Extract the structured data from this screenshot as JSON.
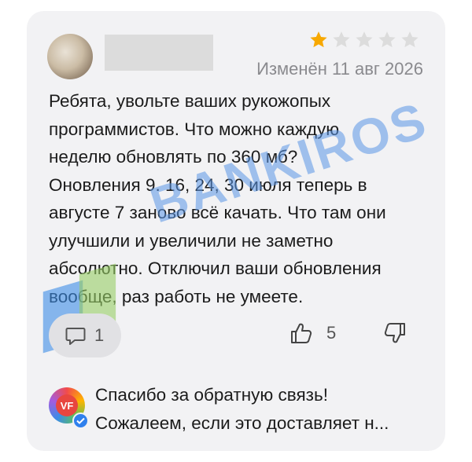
{
  "review": {
    "author_avatar": "user-avatar",
    "rating": 1,
    "max_rating": 5,
    "date": "Изменён 11 авг 2026",
    "text": "Ребята, увольте ваших рукожопых\nпрограммистов. Что можно каждую\nнеделю обновлять по 360 мб?\nОновления 9. 16, 24, 30 июля теперь в\nавгусте 7 заново всё качать. Что там они\nулучшили и увеличили не заметно\nабсолютно. Отключил ваши обновления\nвообще, раз работь не умеете."
  },
  "actions": {
    "comments_count": "1",
    "likes_count": "5"
  },
  "reply": {
    "line1": "Спасибо за обратную связь!",
    "line2": "Сожалеем, если это доставляет н..."
  },
  "watermark": {
    "text": "BANKIROS"
  },
  "colors": {
    "card_bg": "#f2f2f4",
    "star_active": "#f7a800",
    "star_inactive": "#dcdcdc",
    "text_primary": "#1b1b1b",
    "text_secondary": "#8a8a8e",
    "verified_badge": "#2f80ed"
  },
  "icons": [
    "star-icon",
    "comment-icon",
    "thumbs-up-icon",
    "thumbs-down-icon",
    "verified-icon"
  ]
}
